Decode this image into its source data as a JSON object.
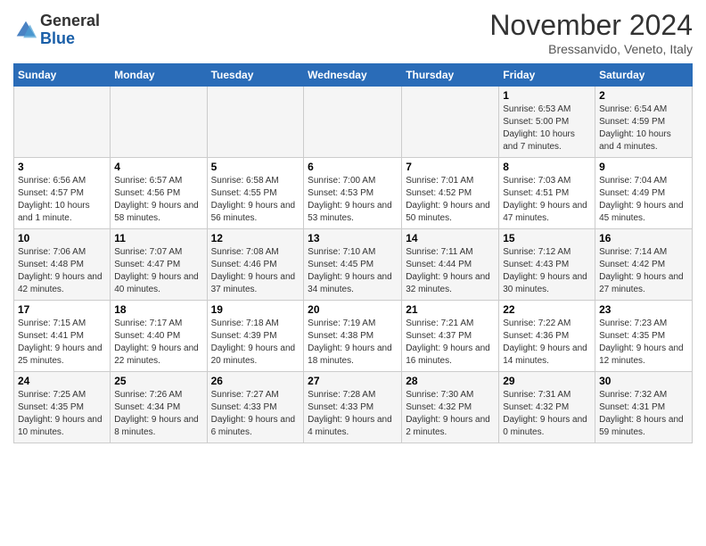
{
  "header": {
    "logo_general": "General",
    "logo_blue": "Blue",
    "month_title": "November 2024",
    "location": "Bressanvido, Veneto, Italy"
  },
  "columns": [
    "Sunday",
    "Monday",
    "Tuesday",
    "Wednesday",
    "Thursday",
    "Friday",
    "Saturday"
  ],
  "weeks": [
    [
      {
        "day": "",
        "info": ""
      },
      {
        "day": "",
        "info": ""
      },
      {
        "day": "",
        "info": ""
      },
      {
        "day": "",
        "info": ""
      },
      {
        "day": "",
        "info": ""
      },
      {
        "day": "1",
        "info": "Sunrise: 6:53 AM\nSunset: 5:00 PM\nDaylight: 10 hours and 7 minutes."
      },
      {
        "day": "2",
        "info": "Sunrise: 6:54 AM\nSunset: 4:59 PM\nDaylight: 10 hours and 4 minutes."
      }
    ],
    [
      {
        "day": "3",
        "info": "Sunrise: 6:56 AM\nSunset: 4:57 PM\nDaylight: 10 hours and 1 minute."
      },
      {
        "day": "4",
        "info": "Sunrise: 6:57 AM\nSunset: 4:56 PM\nDaylight: 9 hours and 58 minutes."
      },
      {
        "day": "5",
        "info": "Sunrise: 6:58 AM\nSunset: 4:55 PM\nDaylight: 9 hours and 56 minutes."
      },
      {
        "day": "6",
        "info": "Sunrise: 7:00 AM\nSunset: 4:53 PM\nDaylight: 9 hours and 53 minutes."
      },
      {
        "day": "7",
        "info": "Sunrise: 7:01 AM\nSunset: 4:52 PM\nDaylight: 9 hours and 50 minutes."
      },
      {
        "day": "8",
        "info": "Sunrise: 7:03 AM\nSunset: 4:51 PM\nDaylight: 9 hours and 47 minutes."
      },
      {
        "day": "9",
        "info": "Sunrise: 7:04 AM\nSunset: 4:49 PM\nDaylight: 9 hours and 45 minutes."
      }
    ],
    [
      {
        "day": "10",
        "info": "Sunrise: 7:06 AM\nSunset: 4:48 PM\nDaylight: 9 hours and 42 minutes."
      },
      {
        "day": "11",
        "info": "Sunrise: 7:07 AM\nSunset: 4:47 PM\nDaylight: 9 hours and 40 minutes."
      },
      {
        "day": "12",
        "info": "Sunrise: 7:08 AM\nSunset: 4:46 PM\nDaylight: 9 hours and 37 minutes."
      },
      {
        "day": "13",
        "info": "Sunrise: 7:10 AM\nSunset: 4:45 PM\nDaylight: 9 hours and 34 minutes."
      },
      {
        "day": "14",
        "info": "Sunrise: 7:11 AM\nSunset: 4:44 PM\nDaylight: 9 hours and 32 minutes."
      },
      {
        "day": "15",
        "info": "Sunrise: 7:12 AM\nSunset: 4:43 PM\nDaylight: 9 hours and 30 minutes."
      },
      {
        "day": "16",
        "info": "Sunrise: 7:14 AM\nSunset: 4:42 PM\nDaylight: 9 hours and 27 minutes."
      }
    ],
    [
      {
        "day": "17",
        "info": "Sunrise: 7:15 AM\nSunset: 4:41 PM\nDaylight: 9 hours and 25 minutes."
      },
      {
        "day": "18",
        "info": "Sunrise: 7:17 AM\nSunset: 4:40 PM\nDaylight: 9 hours and 22 minutes."
      },
      {
        "day": "19",
        "info": "Sunrise: 7:18 AM\nSunset: 4:39 PM\nDaylight: 9 hours and 20 minutes."
      },
      {
        "day": "20",
        "info": "Sunrise: 7:19 AM\nSunset: 4:38 PM\nDaylight: 9 hours and 18 minutes."
      },
      {
        "day": "21",
        "info": "Sunrise: 7:21 AM\nSunset: 4:37 PM\nDaylight: 9 hours and 16 minutes."
      },
      {
        "day": "22",
        "info": "Sunrise: 7:22 AM\nSunset: 4:36 PM\nDaylight: 9 hours and 14 minutes."
      },
      {
        "day": "23",
        "info": "Sunrise: 7:23 AM\nSunset: 4:35 PM\nDaylight: 9 hours and 12 minutes."
      }
    ],
    [
      {
        "day": "24",
        "info": "Sunrise: 7:25 AM\nSunset: 4:35 PM\nDaylight: 9 hours and 10 minutes."
      },
      {
        "day": "25",
        "info": "Sunrise: 7:26 AM\nSunset: 4:34 PM\nDaylight: 9 hours and 8 minutes."
      },
      {
        "day": "26",
        "info": "Sunrise: 7:27 AM\nSunset: 4:33 PM\nDaylight: 9 hours and 6 minutes."
      },
      {
        "day": "27",
        "info": "Sunrise: 7:28 AM\nSunset: 4:33 PM\nDaylight: 9 hours and 4 minutes."
      },
      {
        "day": "28",
        "info": "Sunrise: 7:30 AM\nSunset: 4:32 PM\nDaylight: 9 hours and 2 minutes."
      },
      {
        "day": "29",
        "info": "Sunrise: 7:31 AM\nSunset: 4:32 PM\nDaylight: 9 hours and 0 minutes."
      },
      {
        "day": "30",
        "info": "Sunrise: 7:32 AM\nSunset: 4:31 PM\nDaylight: 8 hours and 59 minutes."
      }
    ]
  ]
}
